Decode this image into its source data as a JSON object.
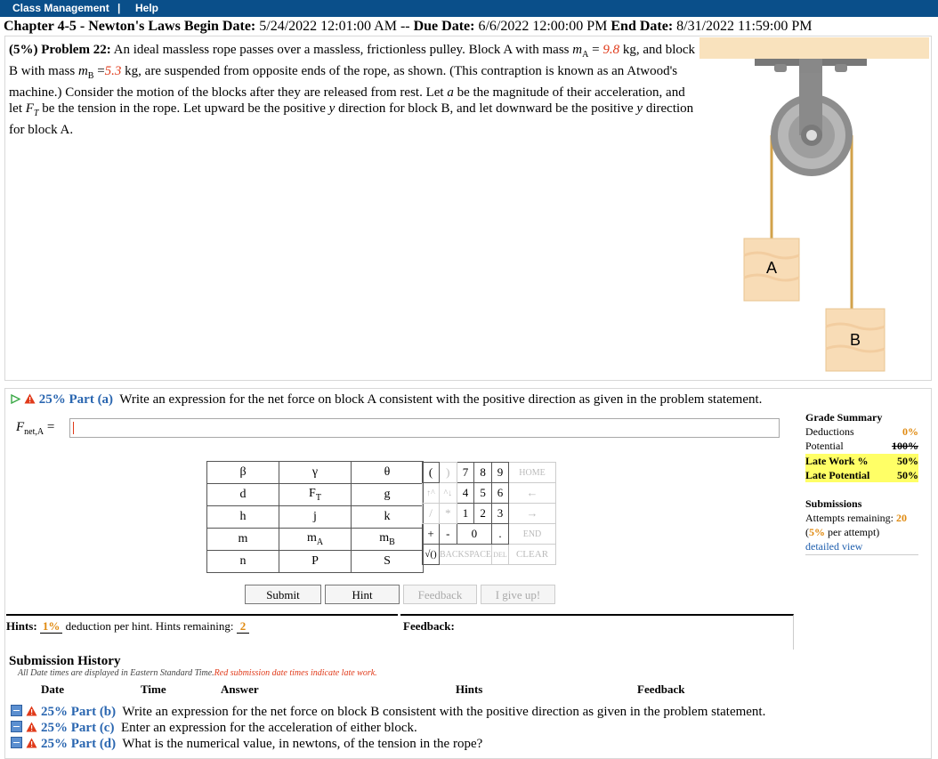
{
  "topbar": {
    "class_management": "Class Management",
    "separator": "|",
    "help": "Help"
  },
  "chapter": {
    "name": "Chapter 4-5 - Newton's Laws",
    "begin_label": "Begin Date:",
    "begin": "5/24/2022 12:01:00 AM",
    "sep": "--",
    "due_label": "Due Date:",
    "due": "6/6/2022 12:00:00 PM",
    "end_label": "End Date:",
    "end": "8/31/2022 11:59:00 PM"
  },
  "problem": {
    "header": "(5%) Problem 22:",
    "t1": "An ideal massless rope passes over a massless, frictionless pulley. Block A with mass ",
    "mA_sym": "m",
    "mA_sub": "A",
    "eq": " =",
    "mA_val": "9.8",
    "t2": " kg, and block B with mass ",
    "mB_sym": "m",
    "mB_sub": "B",
    "eq2": " =",
    "mB_val": "5.3",
    "t3": " kg, are suspended from opposite ends of the rope, as shown. (This contraption is known as an Atwood's machine.) Consider the motion of the blocks after they are released from rest. Let ",
    "a_sym": "a",
    "t4": " be the magnitude of their acceleration, and let ",
    "FT_sym": "F",
    "FT_sub": "T",
    "t5": " be the tension in the rope. Let upward be the positive ",
    "y_sym": "y",
    "t6": " direction for block B, and let downward be the positive ",
    "y_sym2": "y",
    "t7": " direction for block A."
  },
  "figure": {
    "block_a": "A",
    "block_b": "B"
  },
  "part_a": {
    "pct": "25% Part (a)",
    "text": "Write an expression for the net force on block A consistent with the positive direction as given in the problem statement.",
    "label_F": "F",
    "label_sub": "net,A",
    "label_eq": " ="
  },
  "keypad": {
    "rows": [
      [
        "β",
        "γ",
        "θ"
      ],
      [
        "d",
        "F",
        "g"
      ],
      [
        "h",
        "j",
        "k"
      ],
      [
        "m",
        "m",
        "m"
      ],
      [
        "n",
        "P",
        "S"
      ]
    ],
    "FT_sub": "T",
    "mA_sub": "A",
    "mB_sub": "B",
    "paren_open": "(",
    "paren_close": ")",
    "n7": "7",
    "n8": "8",
    "n9": "9",
    "home": "HOME",
    "up": "↑^",
    "updown": "^↓",
    "n4": "4",
    "n5": "5",
    "n6": "6",
    "left": "←",
    "slash": "/",
    "star": "*",
    "n1": "1",
    "n2": "2",
    "n3": "3",
    "right": "→",
    "plus": "+",
    "minus": "-",
    "n0": "0",
    "dot": ".",
    "end": "END",
    "sqrt": "√()",
    "backspace": "BACKSPACE",
    "del": "DEL",
    "clear": "CLEAR"
  },
  "buttons": {
    "submit": "Submit",
    "hint": "Hint",
    "feedback": "Feedback",
    "give_up": "I give up!"
  },
  "grade": {
    "title": "Grade Summary",
    "deductions_label": "Deductions",
    "deductions": "0%",
    "potential_label": "Potential",
    "potential": "100%",
    "late_work_label": "Late Work %",
    "late_work": "50%",
    "late_potential_label": "Late Potential",
    "late_potential": "50%",
    "submissions": "Submissions",
    "attempts_label": "Attempts remaining:",
    "attempts": "20",
    "per_attempt_pct": "5%",
    "per_attempt": " per attempt)",
    "paren": "(",
    "detailed": "detailed view"
  },
  "hints": {
    "label": "Hints:",
    "pct": "1%",
    "text": " deduction per hint. Hints remaining: ",
    "remaining": "2"
  },
  "feedback": {
    "label": "Feedback:"
  },
  "history": {
    "title": "Submission History",
    "note1": "All Date times are displayed in Eastern Standard Time.",
    "note2": "Red submission date times indicate late work.",
    "cols": [
      "Date",
      "Time",
      "Answer",
      "Hints",
      "Feedback"
    ]
  },
  "parts": [
    {
      "pct": "25% Part (b)",
      "text": "Write an expression for the net force on block B consistent with the positive direction as given in the problem statement."
    },
    {
      "pct": "25% Part (c)",
      "text": "Enter an expression for the acceleration of either block."
    },
    {
      "pct": "25% Part (d)",
      "text": "What is the numerical value, in newtons, of the tension in the rope?"
    }
  ]
}
